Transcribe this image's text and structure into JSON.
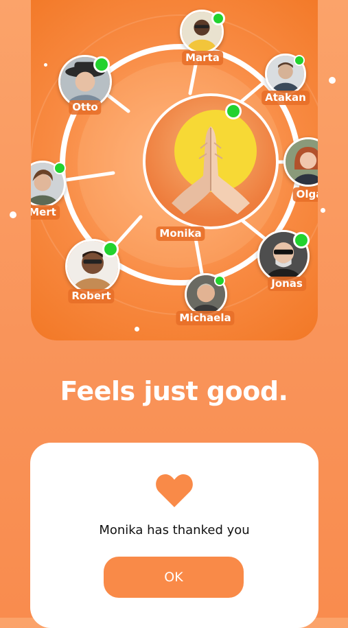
{
  "hero": {
    "center_name": "Monika",
    "center_icon": "praying-hands-icon",
    "contacts": [
      {
        "name": "Marta",
        "online": true
      },
      {
        "name": "Atakan",
        "online": true
      },
      {
        "name": "Olga",
        "online": true
      },
      {
        "name": "Jonas",
        "online": true
      },
      {
        "name": "Michaela",
        "online": true
      },
      {
        "name": "Robert",
        "online": true
      },
      {
        "name": "Mert",
        "online": true
      },
      {
        "name": "Otto",
        "online": true
      }
    ]
  },
  "headline": "Feels just good.",
  "dialog": {
    "icon": "heart-icon",
    "message": "Monika has thanked you",
    "ok_label": "OK"
  },
  "colors": {
    "accent": "#f98a48",
    "online": "#22d22e",
    "sun": "#f7d935"
  }
}
